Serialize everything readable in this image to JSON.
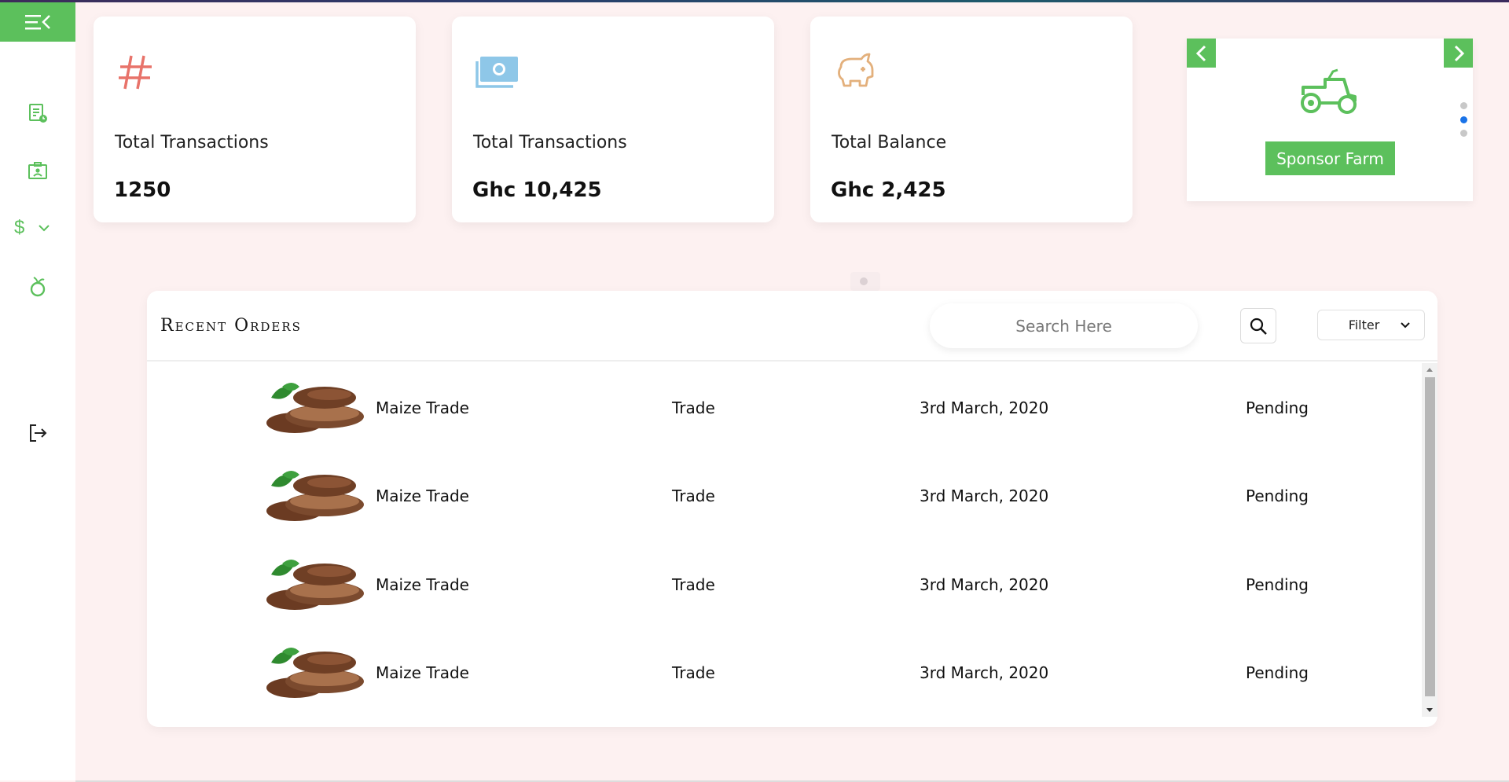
{
  "colors": {
    "accent": "#5cc05c",
    "background": "#fdf1f1",
    "dot_active": "#1a73e8"
  },
  "sidebar": {
    "items": [
      {
        "name": "menu-collapse-icon"
      },
      {
        "name": "receipt-icon"
      },
      {
        "name": "contact-card-icon"
      },
      {
        "name": "dollar-icon",
        "glyph": "$"
      },
      {
        "name": "fruit-icon"
      },
      {
        "name": "logout-icon"
      }
    ]
  },
  "cards": [
    {
      "icon": "hash-icon",
      "label": "Total Transactions",
      "value": "1250"
    },
    {
      "icon": "money-icon",
      "label": "Total Transactions",
      "value": "Ghc 10,425"
    },
    {
      "icon": "piggy-bank-icon",
      "label": "Total Balance",
      "value": "Ghc 2,425"
    }
  ],
  "carousel": {
    "icon": "tractor-icon",
    "button_label": "Sponsor Farm",
    "dots": 3,
    "active_dot": 2
  },
  "orders": {
    "title": "Recent Orders",
    "search_placeholder": "Search Here",
    "filter_label": "Filter",
    "rows": [
      {
        "name": "Maize Trade",
        "type": "Trade",
        "date": "3rd March, 2020",
        "status": "Pending"
      },
      {
        "name": "Maize Trade",
        "type": "Trade",
        "date": "3rd March, 2020",
        "status": "Pending"
      },
      {
        "name": "Maize Trade",
        "type": "Trade",
        "date": "3rd March, 2020",
        "status": "Pending"
      },
      {
        "name": "Maize Trade",
        "type": "Trade",
        "date": "3rd March, 2020",
        "status": "Pending"
      }
    ]
  }
}
